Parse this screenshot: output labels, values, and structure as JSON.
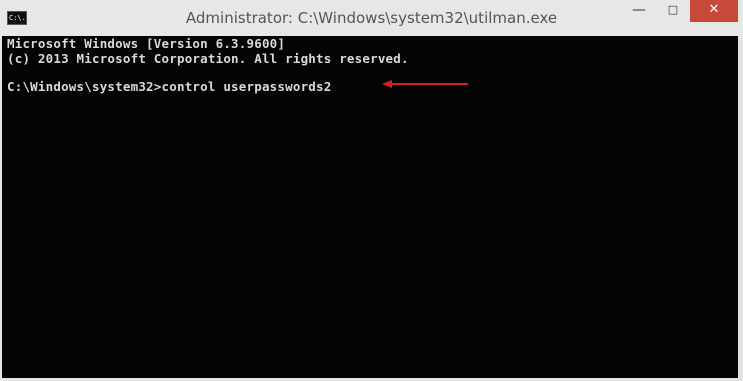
{
  "window": {
    "title": "Administrator: C:\\Windows\\system32\\utilman.exe",
    "icon_label": "C:\\."
  },
  "controls": {
    "minimize": "—",
    "maximize": "□",
    "close": "✕"
  },
  "console": {
    "lines": [
      "Microsoft Windows [Version 6.3.9600]",
      "(c) 2013 Microsoft Corporation. All rights reserved.",
      "C:\\Windows\\system32>control userpasswords2"
    ]
  },
  "annotation": {
    "arrow_color": "#d42020",
    "icon": "arrow-left-icon"
  }
}
